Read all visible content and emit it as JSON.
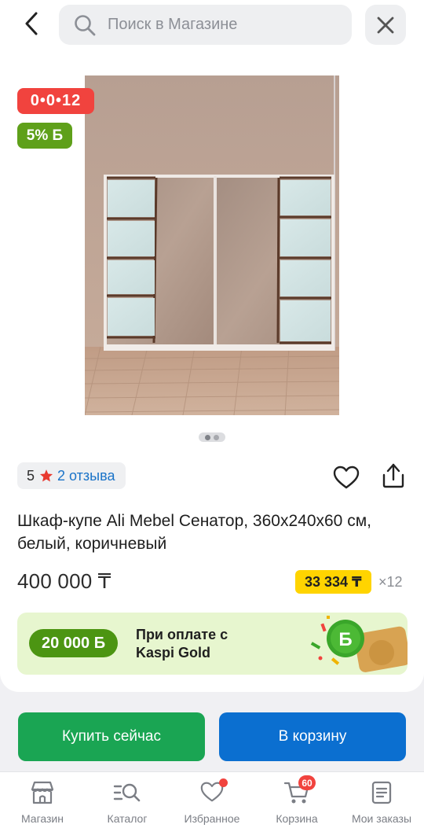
{
  "header": {
    "search_placeholder": "Поиск в Магазине"
  },
  "product": {
    "timer": "0•0•12",
    "bonus_percent": "5% Б",
    "images_total": 2,
    "images_current": 1,
    "rating_score": "5",
    "reviews_label": "2 отзыва",
    "title": "Шкаф-купе Ali Mebel Сенатор, 360x240x60 см, белый, коричневый",
    "price": "400 000 ₸",
    "installment_price": "33 334 ₸",
    "installment_months": "×12"
  },
  "promo": {
    "bonus_amount": "20 000 Б",
    "line1": "При оплате с",
    "line2": "Kaspi Gold"
  },
  "actions": {
    "buy_now": "Купить сейчас",
    "add_to_cart": "В корзину"
  },
  "bottom_nav": {
    "items": [
      {
        "label": "Магазин",
        "icon": "store-icon"
      },
      {
        "label": "Каталог",
        "icon": "catalog-search-icon"
      },
      {
        "label": "Избранное",
        "icon": "heart-icon"
      },
      {
        "label": "Корзина",
        "icon": "cart-icon"
      },
      {
        "label": "Мои заказы",
        "icon": "orders-icon"
      }
    ],
    "cart_count": "60"
  },
  "colors": {
    "timer_red": "#f1433e",
    "bonus_green": "#5fa01a",
    "buy_green": "#1aa553",
    "cart_blue": "#0b6fd0",
    "installment_yellow": "#ffd400",
    "link_blue": "#1a73c8"
  }
}
